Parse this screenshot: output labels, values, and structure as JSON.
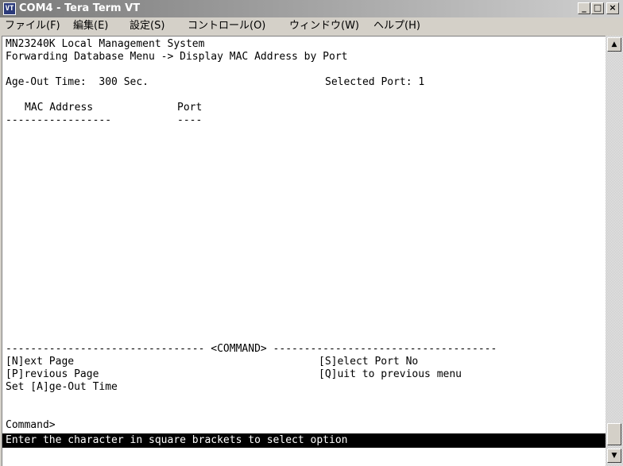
{
  "window": {
    "icon": "terminal-app-icon",
    "title": "COM4 - Tera Term VT",
    "minimize_label": "_",
    "maximize_label": "□",
    "close_label": "×"
  },
  "menu": {
    "items": [
      {
        "label": "ファイル(F)"
      },
      {
        "label": "編集(E)"
      },
      {
        "label": "設定(S)"
      },
      {
        "label": "コントロール(O)"
      },
      {
        "label": "ウィンドウ(W)"
      },
      {
        "label": "ヘルプ(H)"
      }
    ]
  },
  "terminal": {
    "header_line1": "MN23240K Local Management System",
    "header_line2": "Forwarding Database Menu -> Display MAC Address by Port",
    "age_out": "Age-Out Time:  300 Sec.",
    "selected_port": "Selected Port: 1",
    "col_mac": "MAC Address",
    "col_port": "Port",
    "col_mac_rule": "-----------------",
    "col_port_rule": "----",
    "command_divider": "-------------------------------- <COMMAND> ------------------------------------",
    "cmd_next": "[N]ext Page",
    "cmd_select": "[S]elect Port No",
    "cmd_previous": "[P]revious Page",
    "cmd_quit": "[Q]uit to previous menu",
    "cmd_ageout": "Set [A]ge-Out Time",
    "prompt": "Command>",
    "status": "Enter the character in square brackets to select option"
  },
  "scrollbar": {
    "up_icon": "scroll-up-arrow-icon",
    "down_icon": "scroll-down-arrow-icon"
  }
}
